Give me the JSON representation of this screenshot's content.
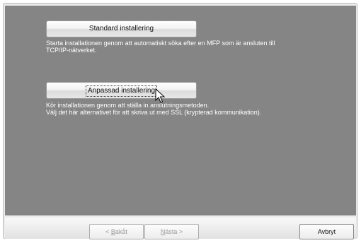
{
  "options": {
    "standard": {
      "label": "Standard installering",
      "description_line1": "Starta installationen genom att automatiskt söka efter en MFP som är ansluten till",
      "description_line2": "TCP/IP-nätverket."
    },
    "custom": {
      "label": "Anpassad installering",
      "description_line1": "Kör installationen genom att ställa in anslutningsmetoden.",
      "description_line2": "Välj det här alternativet för att skriva ut med SSL (krypterad kommunikation)."
    }
  },
  "footer": {
    "back": {
      "prefix": "< ",
      "accel": "B",
      "rest": "akåt"
    },
    "next": {
      "accel": "N",
      "rest": "ästa",
      "suffix": " >"
    },
    "cancel": "Avbryt"
  }
}
